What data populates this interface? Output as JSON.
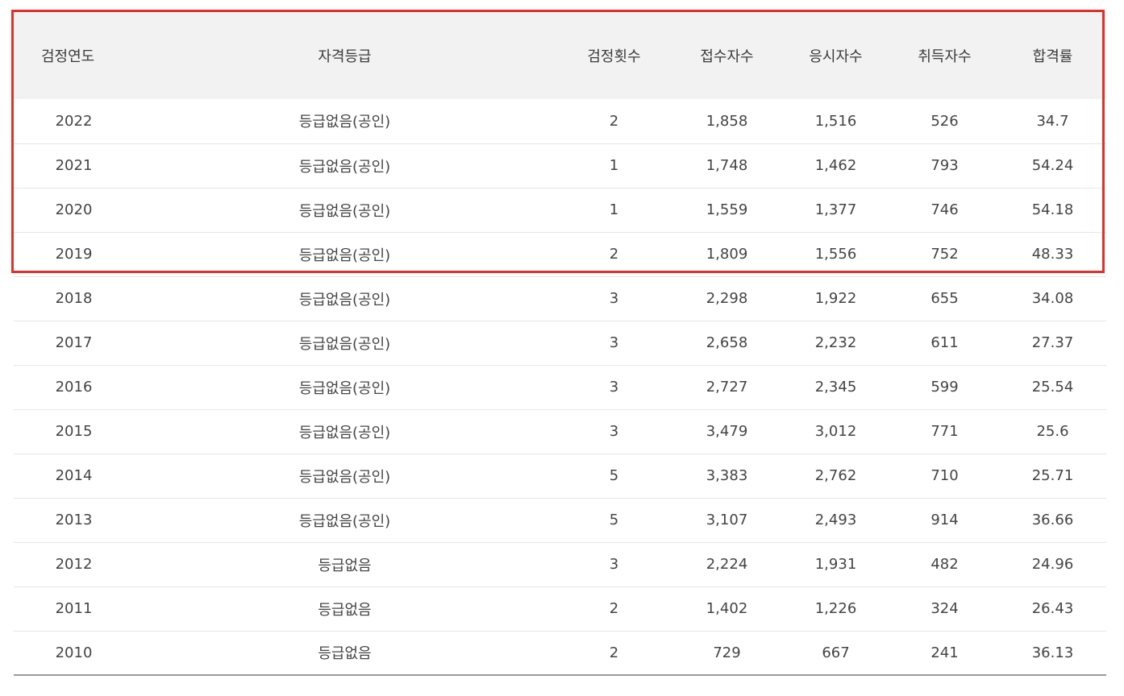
{
  "table": {
    "headers": [
      "검정연도",
      "자격등급",
      "검정횟수",
      "접수자수",
      "응시자수",
      "취득자수",
      "합격률"
    ],
    "rows": [
      [
        "2022",
        "등급없음(공인)",
        "2",
        "1,858",
        "1,516",
        "526",
        "34.7"
      ],
      [
        "2021",
        "등급없음(공인)",
        "1",
        "1,748",
        "1,462",
        "793",
        "54.24"
      ],
      [
        "2020",
        "등급없음(공인)",
        "1",
        "1,559",
        "1,377",
        "746",
        "54.18"
      ],
      [
        "2019",
        "등급없음(공인)",
        "2",
        "1,809",
        "1,556",
        "752",
        "48.33"
      ],
      [
        "2018",
        "등급없음(공인)",
        "3",
        "2,298",
        "1,922",
        "655",
        "34.08"
      ],
      [
        "2017",
        "등급없음(공인)",
        "3",
        "2,658",
        "2,232",
        "611",
        "27.37"
      ],
      [
        "2016",
        "등급없음(공인)",
        "3",
        "2,727",
        "2,345",
        "599",
        "25.54"
      ],
      [
        "2015",
        "등급없음(공인)",
        "3",
        "3,479",
        "3,012",
        "771",
        "25.6"
      ],
      [
        "2014",
        "등급없음(공인)",
        "5",
        "3,383",
        "2,762",
        "710",
        "25.71"
      ],
      [
        "2013",
        "등급없음(공인)",
        "5",
        "3,107",
        "2,493",
        "914",
        "36.66"
      ],
      [
        "2012",
        "등급없음",
        "3",
        "2,224",
        "1,931",
        "482",
        "24.96"
      ],
      [
        "2011",
        "등급없음",
        "2",
        "1,402",
        "1,226",
        "324",
        "26.43"
      ],
      [
        "2010",
        "등급없음",
        "2",
        "729",
        "667",
        "241",
        "36.13"
      ]
    ]
  },
  "highlight": {
    "color": "#e0302a",
    "covers_rows": [
      "2022",
      "2021",
      "2020",
      "2019"
    ]
  }
}
